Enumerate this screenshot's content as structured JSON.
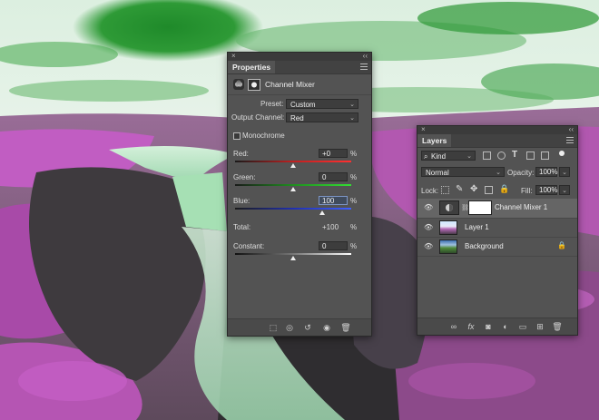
{
  "properties_panel": {
    "tab_label": "Properties",
    "adjustment_title": "Channel Mixer",
    "preset_label": "Preset:",
    "preset_value": "Custom",
    "output_channel_label": "Output Channel:",
    "output_channel_value": "Red",
    "monochrome_label": "Monochrome",
    "monochrome_checked": false,
    "sliders": [
      {
        "label": "Red:",
        "value": "+0",
        "unit": "%",
        "level": 0.5
      },
      {
        "label": "Green:",
        "value": "0",
        "unit": "%",
        "level": 0.5
      },
      {
        "label": "Blue:",
        "value": "100",
        "unit": "%",
        "level": 0.75
      }
    ],
    "total_label": "Total:",
    "total_value": "+100",
    "total_unit": "%",
    "constant_label": "Constant:",
    "constant_value": "0",
    "constant_unit": "%",
    "constant_level": 0.5
  },
  "layers_panel": {
    "tab_label": "Layers",
    "filter_kind": "Kind",
    "blend_mode": "Normal",
    "opacity_label": "Opacity:",
    "opacity_value": "100%",
    "lock_label": "Lock:",
    "fill_label": "Fill:",
    "fill_value": "100%",
    "layers": [
      {
        "name": "Channel Mixer 1",
        "selected": true,
        "visible": true
      },
      {
        "name": "Layer 1",
        "selected": false,
        "visible": true
      },
      {
        "name": "Background",
        "selected": false,
        "visible": true,
        "locked": true
      }
    ]
  },
  "colors": {
    "panel_bg": "#535353",
    "sky_green": "#2f9a3a",
    "foliage_magenta": "#c055c0",
    "water_mint": "#bfe8c8"
  }
}
